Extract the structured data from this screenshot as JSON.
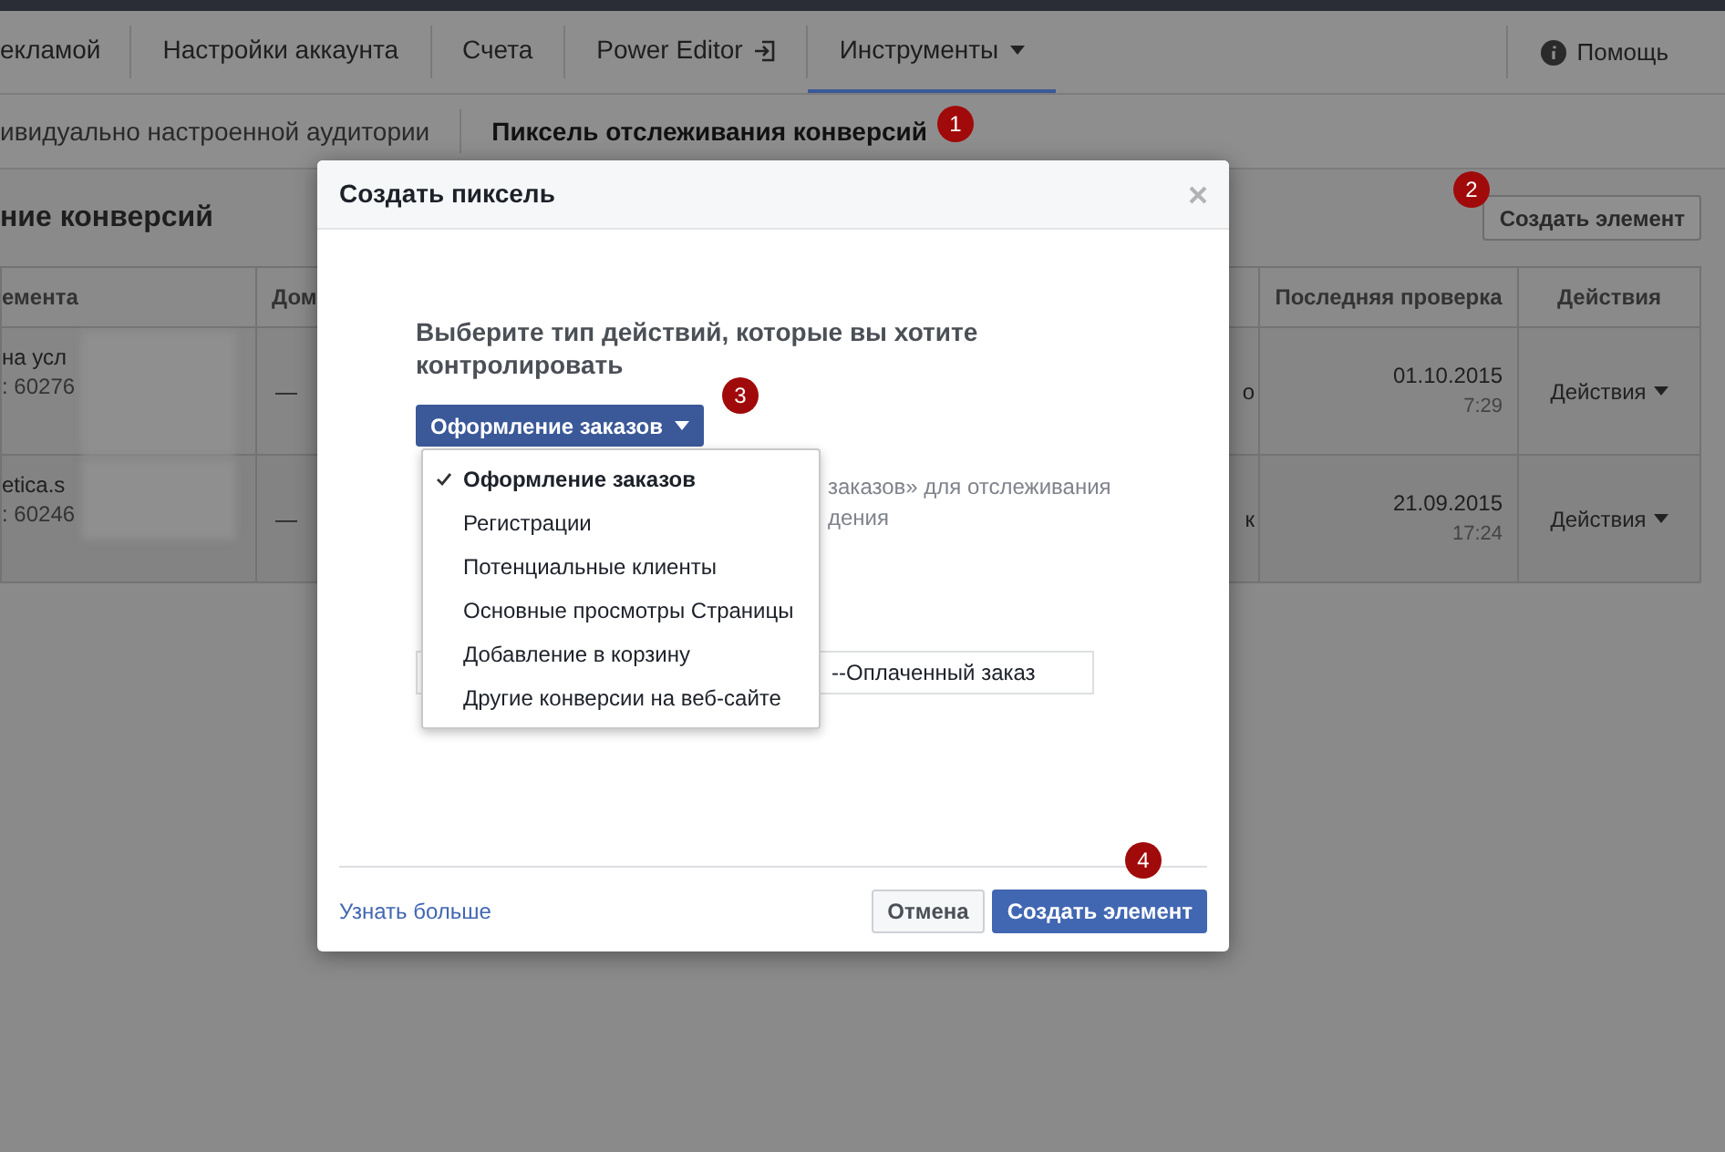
{
  "nav": {
    "items": [
      {
        "label": "екламой",
        "selected": false,
        "kind": "plain"
      },
      {
        "label": "Настройки аккаунта",
        "selected": false,
        "kind": "plain"
      },
      {
        "label": "Счета",
        "selected": false,
        "kind": "plain"
      },
      {
        "label": "Power Editor",
        "selected": false,
        "kind": "external"
      },
      {
        "label": "Инструменты",
        "selected": true,
        "kind": "menu"
      }
    ],
    "help": "Помощь"
  },
  "subnav": {
    "tabs": [
      {
        "label": "ивидуально настроенной аудитории",
        "selected": false
      },
      {
        "label": "Пиксель отслеживания конверсий",
        "selected": true
      }
    ]
  },
  "page": {
    "title": "ние конверсий",
    "create_button": "Создать элемент"
  },
  "table": {
    "columns": [
      "емента",
      "Дом",
      "Последняя проверка",
      "Действия"
    ],
    "rows": [
      {
        "name": "на усл",
        "id": ": 60276",
        "domain": "—",
        "column_3": "о",
        "date": "01.10.2015",
        "time": "7:29",
        "actions": "Действия"
      },
      {
        "name": "etica.s",
        "id": ": 60246",
        "domain": "—",
        "column_3": "к",
        "date": "21.09.2015",
        "time": "17:24",
        "actions": "Действия"
      }
    ]
  },
  "annotations": [
    "1",
    "2",
    "3",
    "4"
  ],
  "dialog": {
    "title": "Создать пиксель",
    "prompt": "Выберите тип действий, которые вы хотите контролировать",
    "select": {
      "value": "Оформление заказов"
    },
    "menu": [
      {
        "label": "Оформление заказов",
        "selected": true
      },
      {
        "label": "Регистрации",
        "selected": false
      },
      {
        "label": "Потенциальные клиенты",
        "selected": false
      },
      {
        "label": "Основные просмотры Страницы",
        "selected": false
      },
      {
        "label": "Добавление в корзину",
        "selected": false
      },
      {
        "label": "Другие конверсии на веб-сайте",
        "selected": false
      }
    ],
    "hint": [
      "заказов» для отслеживания",
      "дения"
    ],
    "field": {
      "value": "--Оплаченный заказ"
    },
    "learn_more": "Узнать больше",
    "cancel": "Отмена",
    "submit": "Создать элемент"
  }
}
